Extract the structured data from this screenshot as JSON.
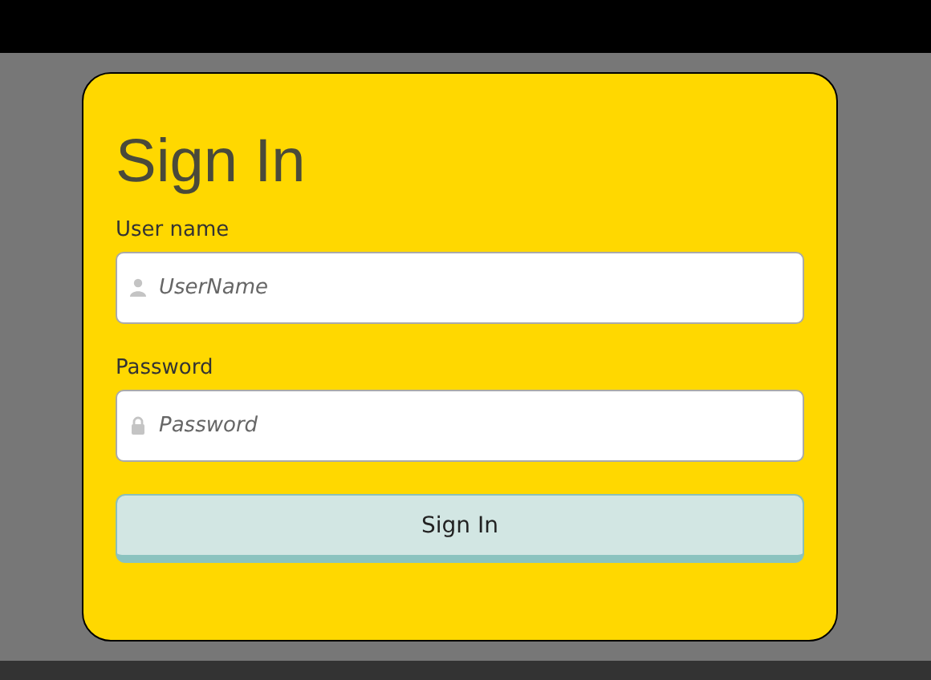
{
  "form": {
    "title": "Sign In",
    "fields": [
      {
        "label": "User name",
        "placeholder": "UserName",
        "kind": "user"
      },
      {
        "label": "Password",
        "placeholder": "Password",
        "kind": "password"
      }
    ],
    "button": "Sign In"
  }
}
